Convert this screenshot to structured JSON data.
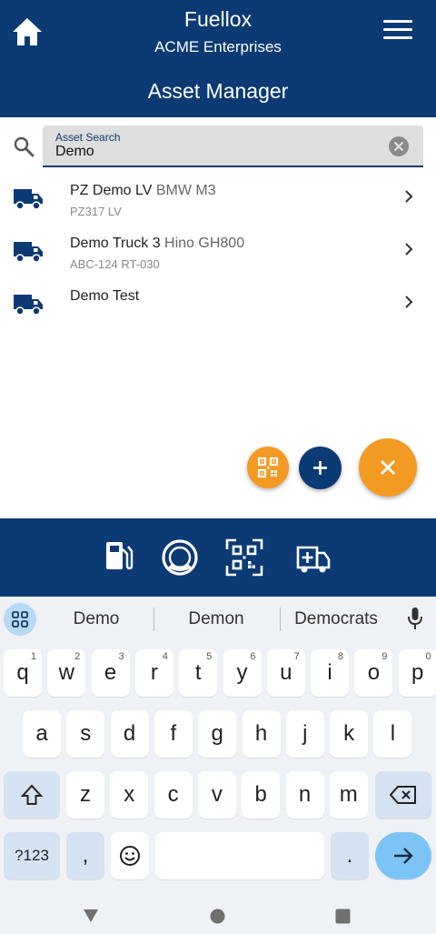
{
  "header": {
    "app_title": "Fuellox",
    "company": "ACME Enterprises",
    "page_title": "Asset Manager"
  },
  "search": {
    "label": "Asset Search",
    "value": "Demo"
  },
  "assets": [
    {
      "name": "PZ Demo LV",
      "model": "BMW M3",
      "sub": "PZ317 LV"
    },
    {
      "name": "Demo Truck 3",
      "model": "Hino GH800",
      "sub": "ABC-124 RT-030"
    },
    {
      "name": "Demo Test",
      "model": "",
      "sub": ""
    }
  ],
  "bottom_bar": {
    "icons": [
      "fuel-pump-icon",
      "tire-gauge-icon",
      "qr-scan-icon",
      "ambulance-icon"
    ]
  },
  "keyboard": {
    "suggestions": [
      "Demo",
      "Demon",
      "Democrats"
    ],
    "row1": [
      {
        "k": "q",
        "h": "1"
      },
      {
        "k": "w",
        "h": "2"
      },
      {
        "k": "e",
        "h": "3"
      },
      {
        "k": "r",
        "h": "4"
      },
      {
        "k": "t",
        "h": "5"
      },
      {
        "k": "y",
        "h": "6"
      },
      {
        "k": "u",
        "h": "7"
      },
      {
        "k": "i",
        "h": "8"
      },
      {
        "k": "o",
        "h": "9"
      },
      {
        "k": "p",
        "h": "0"
      }
    ],
    "row2": [
      "a",
      "s",
      "d",
      "f",
      "g",
      "h",
      "j",
      "k",
      "l"
    ],
    "row3": [
      "z",
      "x",
      "c",
      "v",
      "b",
      "n",
      "m"
    ],
    "symbols_label": "?123",
    "comma": ",",
    "period": "."
  },
  "colors": {
    "primary": "#0c3a74",
    "accent": "#f39a23"
  }
}
